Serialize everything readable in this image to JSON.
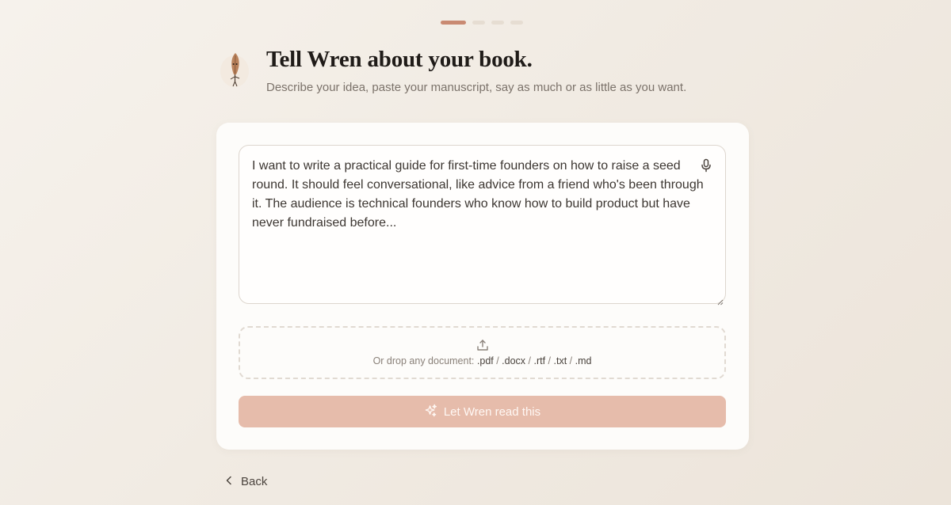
{
  "progress": {
    "total_steps": 4,
    "current_step": 1
  },
  "header": {
    "title": "Tell Wren about your book.",
    "subtitle": "Describe your idea, paste your manuscript, say as much or as little as you want.",
    "mascot_icon": "quill-mascot-icon"
  },
  "idea_input": {
    "value": "I want to write a practical guide for first-time founders on how to raise a seed round. It should feel conversational, like advice from a friend who's been through it. The audience is technical founders who know how to build product but have never fundraised before...",
    "mic_icon": "microphone-icon"
  },
  "dropzone": {
    "icon": "upload-icon",
    "prefix": "Or drop any document: ",
    "formats": [
      ".pdf",
      ".docx",
      ".rtf",
      ".txt",
      ".md"
    ],
    "separator": " / "
  },
  "cta": {
    "label": "Let Wren read this",
    "icon": "sparkles-icon"
  },
  "back": {
    "label": "Back",
    "icon": "chevron-left-icon"
  },
  "colors": {
    "accent": "#c98a72",
    "cta_background": "#e6bcab",
    "card_background": "#fdfcfa",
    "page_background": "#f3eee7"
  }
}
